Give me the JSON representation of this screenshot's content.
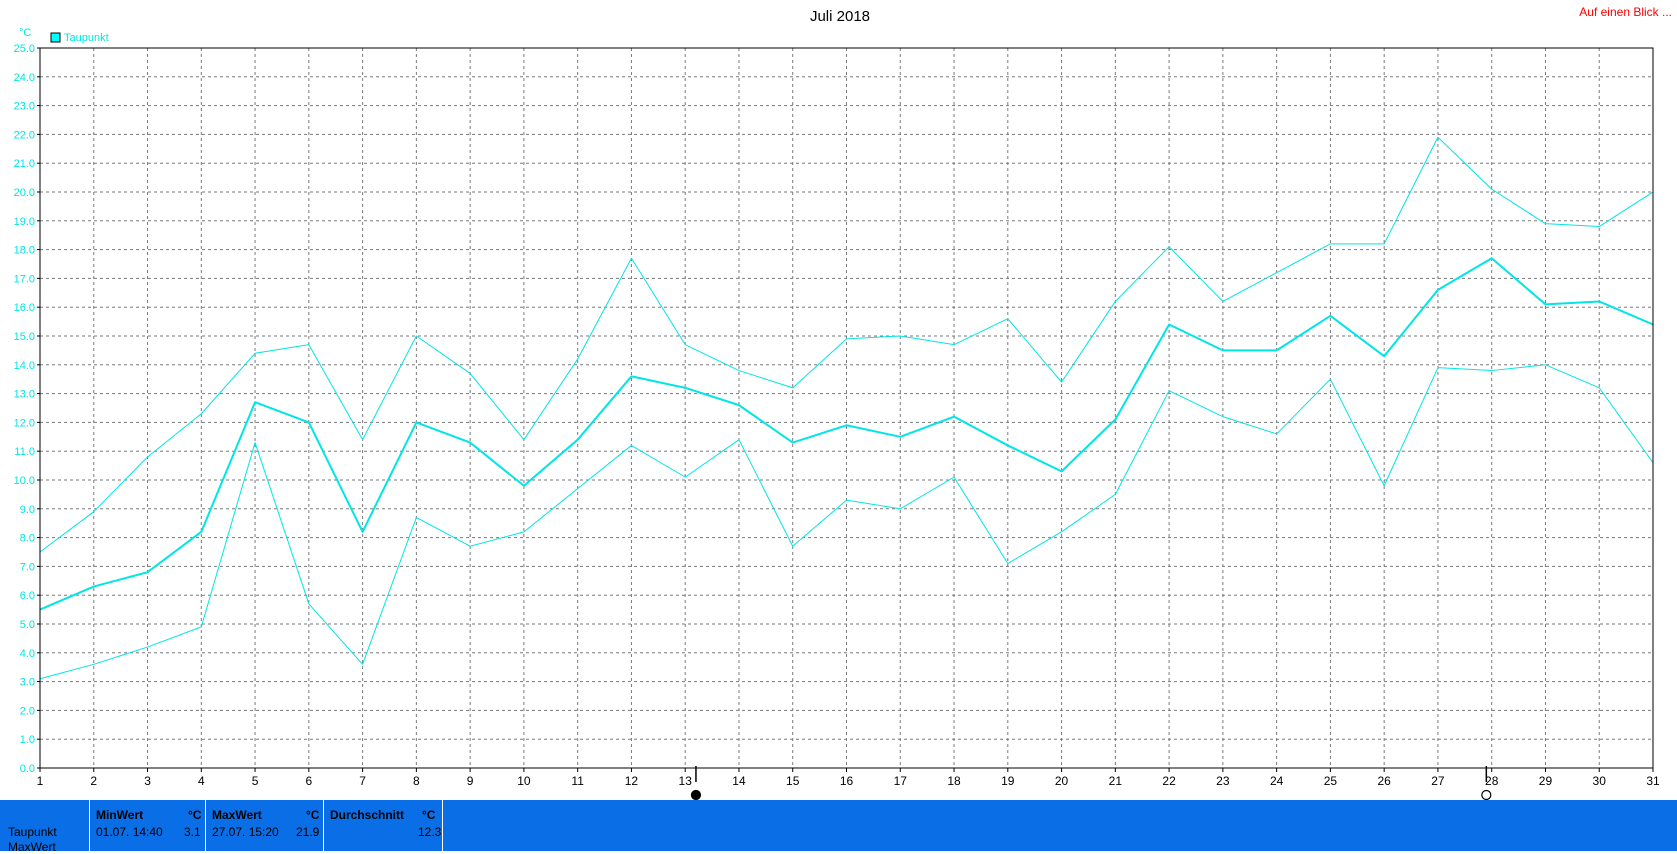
{
  "chart_data": {
    "type": "line",
    "title": "Juli 2018",
    "ylabel": "°C",
    "ylim": [
      0,
      25
    ],
    "ytick_step": 1,
    "xlim": [
      1,
      31
    ],
    "categories": [
      "1",
      "2",
      "3",
      "4",
      "5",
      "6",
      "7",
      "8",
      "9",
      "10",
      "11",
      "12",
      "13",
      "14",
      "15",
      "16",
      "17",
      "18",
      "19",
      "20",
      "21",
      "22",
      "23",
      "24",
      "25",
      "26",
      "27",
      "28",
      "29",
      "30",
      "31"
    ],
    "legend": [
      {
        "name": "Taupunkt",
        "color": "#00ffff"
      }
    ],
    "legend_position": "top-left",
    "grid": true,
    "series": [
      {
        "name": "Max",
        "color": "#00e5e5",
        "width": 1,
        "values": [
          7.5,
          8.9,
          10.8,
          12.3,
          14.4,
          14.7,
          11.4,
          15.0,
          13.7,
          11.4,
          14.2,
          17.7,
          14.7,
          13.8,
          13.2,
          14.9,
          15.0,
          14.7,
          15.6,
          13.4,
          16.2,
          18.1,
          16.2,
          17.2,
          18.2,
          18.2,
          21.9,
          20.1,
          18.9,
          18.8,
          20.0
        ]
      },
      {
        "name": "Durchschnitt",
        "color": "#00e5e5",
        "width": 2,
        "values": [
          5.5,
          6.3,
          6.8,
          8.2,
          12.7,
          12.0,
          8.2,
          12.0,
          11.3,
          9.8,
          11.4,
          13.6,
          13.2,
          12.6,
          11.3,
          11.9,
          11.5,
          12.2,
          11.2,
          10.3,
          12.1,
          15.4,
          14.5,
          14.5,
          15.7,
          14.3,
          16.6,
          17.7,
          16.1,
          16.2,
          15.4
        ]
      },
      {
        "name": "Min",
        "color": "#00e5e5",
        "width": 1,
        "values": [
          3.1,
          3.6,
          4.2,
          4.9,
          11.3,
          5.7,
          3.6,
          8.7,
          7.7,
          8.2,
          9.7,
          11.2,
          10.1,
          11.4,
          7.7,
          9.3,
          9.0,
          10.1,
          7.1,
          8.2,
          9.5,
          13.1,
          12.2,
          11.6,
          13.5,
          9.8,
          13.9,
          13.8,
          14.0,
          13.2,
          10.6
        ]
      }
    ],
    "markers": [
      {
        "x": 13.2,
        "type": "full-moon"
      },
      {
        "x": 27.9,
        "type": "new-moon"
      }
    ]
  },
  "unit_label": "°C",
  "link": "Auf einen Blick ...",
  "stats": {
    "row_labels": [
      "Taupunkt",
      "MaxWert"
    ],
    "columns": [
      {
        "header": "MinWert",
        "unit": "°C",
        "date": "01.07.  14:40",
        "value": "3.1"
      },
      {
        "header": "MaxWert",
        "unit": "°C",
        "date": "27.07.  15:20",
        "value": "21.9"
      },
      {
        "header": "Durchschnitt",
        "unit": "°C",
        "date": "",
        "value": "12.3"
      }
    ]
  }
}
